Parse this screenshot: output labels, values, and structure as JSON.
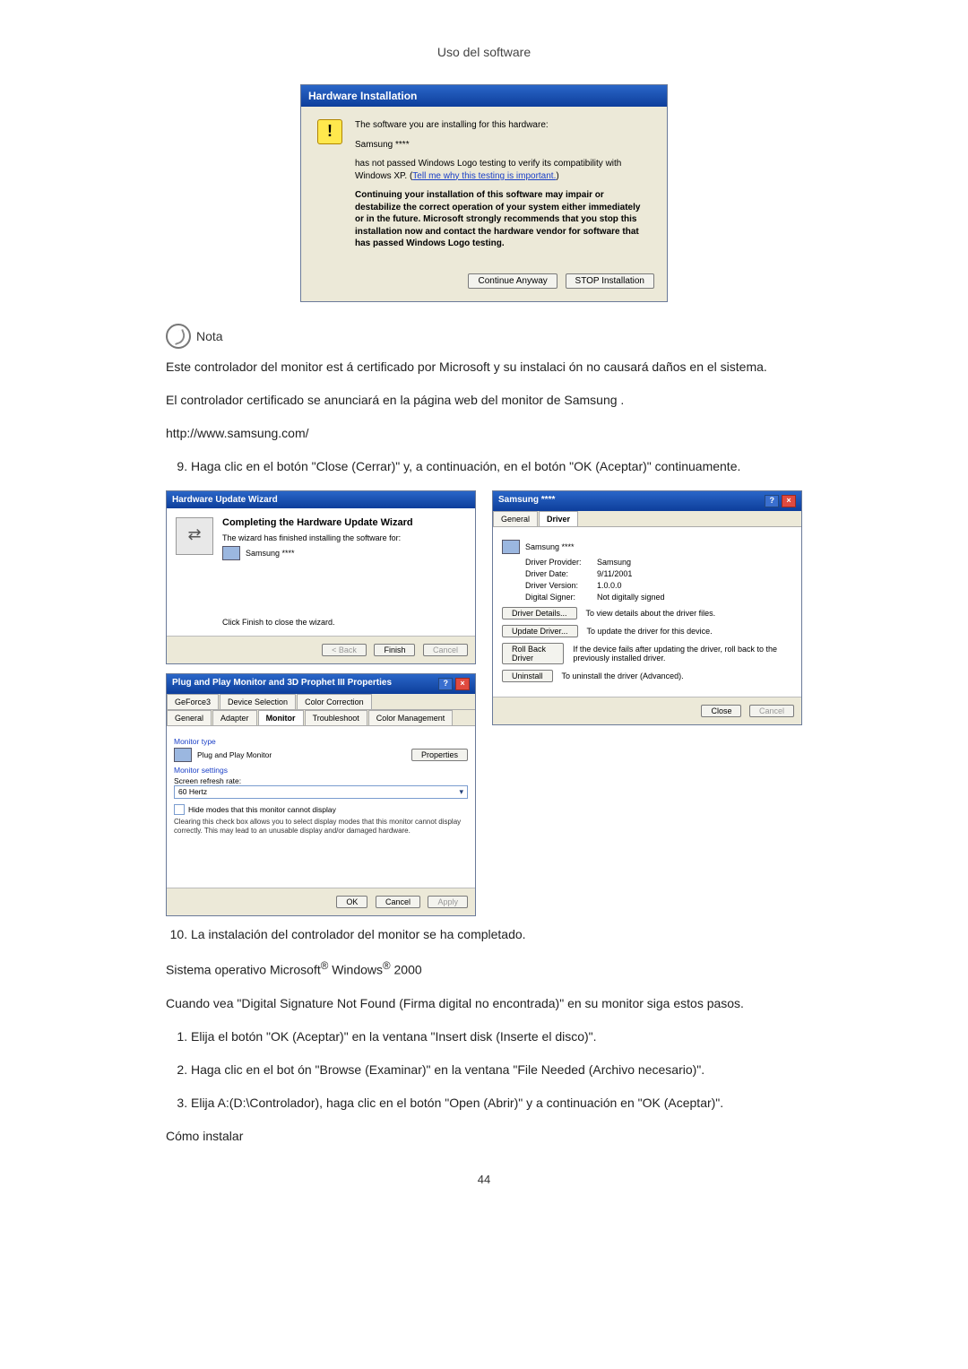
{
  "header": {
    "title": "Uso del software"
  },
  "hwinstall": {
    "title": "Hardware Installation",
    "line1": "The software you are installing for this hardware:",
    "device": "Samsung ****",
    "line2a": "has not passed Windows Logo testing to verify its compatibility with Windows XP. (",
    "link": "Tell me why this testing is important.",
    "line2b": ")",
    "bold": "Continuing your installation of this software may impair or destabilize the correct operation of your system either immediately or in the future. Microsoft strongly recommends that you stop this installation now and contact the hardware vendor for software that has passed Windows Logo testing.",
    "btn_continue": "Continue Anyway",
    "btn_stop": "STOP Installation"
  },
  "note": {
    "label": "Nota"
  },
  "para1": "Este controlador del monitor est á certificado por Microsoft y su instalaci ón no causará daños en el sistema.",
  "para2": "El controlador certificado se anunciará en la página web del monitor de Samsung .",
  "url": "http://www.samsung.com/",
  "step9": "Haga clic en el botón \"Close (Cerrar)\" y, a continuación, en el botón \"OK (Aceptar)\" continuamente.",
  "huw": {
    "title": "Hardware Update Wizard",
    "completing": "Completing the Hardware Update Wizard",
    "finished": "The wizard has finished installing the software for:",
    "device": "Samsung ****",
    "click": "Click Finish to close the wizard.",
    "back": "< Back",
    "finish": "Finish",
    "cancel": "Cancel"
  },
  "props": {
    "title": "Samsung ****",
    "tab_general": "General",
    "tab_driver": "Driver",
    "device": "Samsung ****",
    "k_provider": "Driver Provider:",
    "v_provider": "Samsung",
    "k_date": "Driver Date:",
    "v_date": "9/11/2001",
    "k_version": "Driver Version:",
    "v_version": "1.0.0.0",
    "k_signer": "Digital Signer:",
    "v_signer": "Not digitally signed",
    "btn_details": "Driver Details...",
    "txt_details": "To view details about the driver files.",
    "btn_update": "Update Driver...",
    "txt_update": "To update the driver for this device.",
    "btn_rollback": "Roll Back Driver",
    "txt_rollback": "If the device fails after updating the driver, roll back to the previously installed driver.",
    "btn_uninstall": "Uninstall",
    "txt_uninstall": "To uninstall the driver (Advanced).",
    "close": "Close",
    "cancel": "Cancel"
  },
  "plug": {
    "title": "Plug and Play Monitor and 3D Prophet III Properties",
    "tab_geforce": "GeForce3",
    "tab_device": "Device Selection",
    "tab_color": "Color Correction",
    "tab_general": "General",
    "tab_adapter": "Adapter",
    "tab_monitor": "Monitor",
    "tab_trouble": "Troubleshoot",
    "tab_colorm": "Color Management",
    "sec_type": "Monitor type",
    "type_val": "Plug and Play Monitor",
    "btn_properties": "Properties",
    "sec_settings": "Monitor settings",
    "lbl_refresh": "Screen refresh rate:",
    "refresh_val": "60 Hertz",
    "cb_hide": "Hide modes that this monitor cannot display",
    "note": "Clearing this check box allows you to select display modes that this monitor cannot display correctly. This may lead to an unusable display and/or damaged hardware.",
    "ok": "OK",
    "cancel": "Cancel",
    "apply": "Apply"
  },
  "step10": "La instalación del controlador del monitor se ha completado.",
  "os_line": {
    "pre": "Sistema operativo Microsoft",
    "mid": " Windows",
    "post": " 2000"
  },
  "para3": "Cuando vea \"Digital Signature Not Found (Firma digital no encontrada)\" en su monitor siga estos pasos.",
  "s1": "Elija el botón \"OK (Aceptar)\" en la ventana \"Insert disk (Inserte el disco)\".",
  "s2": "Haga clic en el bot ón \"Browse (Examinar)\" en la ventana \"File Needed (Archivo necesario)\".",
  "s3": "Elija A:(D:\\Controlador), haga clic en el botón \"Open (Abrir)\" y a continuación en \"OK (Aceptar)\".",
  "howto": "Cómo instalar",
  "page_number": "44"
}
